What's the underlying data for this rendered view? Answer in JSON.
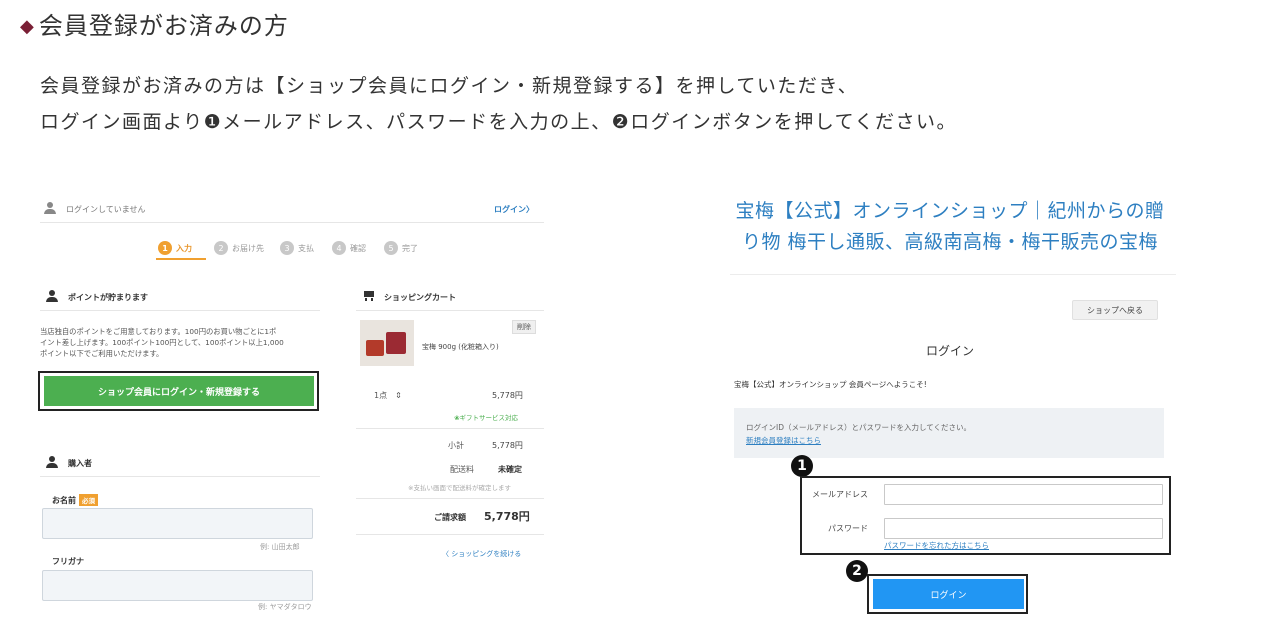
{
  "heading": {
    "marker": "◆",
    "text": "会員登録がお済みの方"
  },
  "intro": {
    "line1": "会員登録がお済みの方は【ショップ会員にログイン・新規登録する】を押していただき、",
    "line2": "ログイン画面より❶メールアドレス、パスワードを入力の上、❷ログインボタンを押してください。"
  },
  "cart_page": {
    "not_logged_in": "ログインしていません",
    "login_link": "ログイン〉",
    "steps": [
      {
        "num": "1",
        "label": "入力"
      },
      {
        "num": "2",
        "label": "お届け先"
      },
      {
        "num": "3",
        "label": "支払"
      },
      {
        "num": "4",
        "label": "確認"
      },
      {
        "num": "5",
        "label": "完了"
      }
    ],
    "points_title": "ポイントが貯まります",
    "points_desc_1": "当店独自のポイントをご用意しております。100円のお買い物ごとに1ポ",
    "points_desc_2": "イント差し上げます。100ポイント100円として、100ポイント以上1,000",
    "points_desc_3": "ポイント以下でご利用いただけます。",
    "register_button": "ショップ会員にログイン・新規登録する",
    "buyer_title": "購入者",
    "name_label": "お名前",
    "required_badge": "必須",
    "name_example": "例: 山田太郎",
    "kana_label": "フリガナ",
    "kana_example": "例: ヤマダタロウ",
    "cart": {
      "title": "ショッピングカート",
      "delete_button": "削除",
      "product_name": "宝梅 900g (化粧箱入り)",
      "quantity": "1点",
      "price": "5,778円",
      "gift_note": "ギフトサービス対応",
      "subtotal_label": "小計",
      "subtotal_value": "5,778円",
      "shipping_label": "配送料",
      "shipping_value": "未確定",
      "shipping_note": "※支払い画面で配送料が確定します",
      "total_label": "ご請求額",
      "total_value": "5,778円",
      "continue_link": "〈 ショッピングを続ける"
    }
  },
  "login_page": {
    "shop_title_line1": "宝梅【公式】オンラインショップ｜紀州からの贈",
    "shop_title_line2": "り物 梅干し通販、高級南高梅・梅干販売の宝梅",
    "back_button": "ショップへ戻る",
    "login_heading": "ログイン",
    "welcome": "宝梅【公式】オンラインショップ 会員ページへようこそ!",
    "info_text": "ログインID（メールアドレス）とパスワードを入力してください。",
    "register_link": "新規会員登録はこちら",
    "email_label": "メールアドレス",
    "password_label": "パスワード",
    "forgot_link": "パスワードを忘れた方はこちら",
    "login_button": "ログイン",
    "marker_1": "1",
    "marker_2": "2"
  },
  "colors": {
    "accent_dark_red": "#7a1f35",
    "register_green": "#4caf50",
    "login_blue": "#2196f3",
    "title_blue": "#2d7fc1",
    "step_orange": "#f0a030"
  }
}
